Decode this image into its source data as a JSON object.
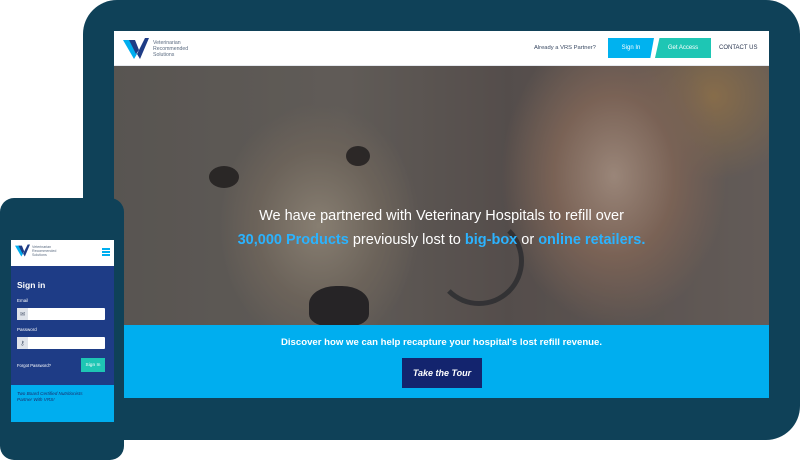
{
  "tablet": {
    "logo": {
      "icon": "vrs-logo-icon",
      "lines": [
        "Veterinarian",
        "Recommended",
        "Solutions"
      ]
    },
    "nav": {
      "partner_text": "Already a VRS Partner?",
      "sign_in": "Sign In",
      "get_access": "Get Access",
      "contact": "CONTACT US"
    },
    "hero": {
      "line1": "We have partnered with Veterinary Hospitals to refill over",
      "line2_hl1": "30,000 Products",
      "line2_mid": " previously lost to ",
      "line2_hl2": "big-box",
      "line2_or": " or ",
      "line2_hl3": "online retailers."
    },
    "band": {
      "text": "Discover how we can help recapture your hospital's lost refill revenue.",
      "button": "Take the Tour"
    }
  },
  "phone": {
    "logo": {
      "icon": "vrs-logo-icon",
      "lines": [
        "Veterinarian",
        "Recommended",
        "Solutions"
      ]
    },
    "menu_icon": "hamburger-menu-icon",
    "signin": {
      "title": "Sign in",
      "email_label": "Email",
      "email_icon": "envelope-icon",
      "email_value": "",
      "password_label": "Password",
      "password_icon": "key-icon",
      "password_value": "",
      "forgot": "Forgot Password?",
      "button": "Sign In"
    },
    "band_text": "Two Board Certified Nutritionists Partner With VRS!"
  },
  "colors": {
    "frame": "#0f4158",
    "accent_blue": "#00aeef",
    "accent_teal": "#1ec6b4",
    "navy": "#13246e",
    "highlight": "#2bb3ff"
  }
}
